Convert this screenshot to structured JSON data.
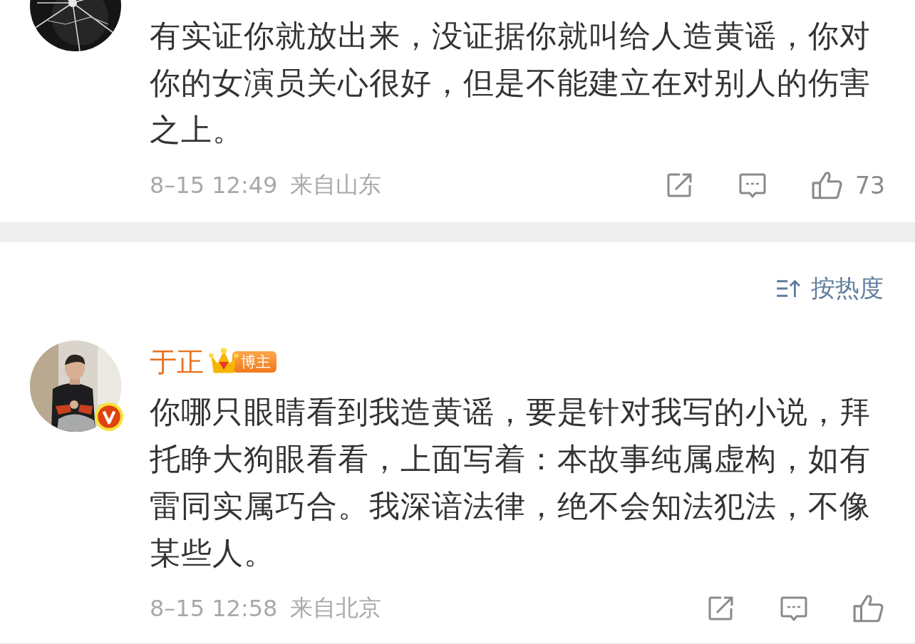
{
  "comments": [
    {
      "verified": false,
      "text": "有实证你就放出来，没证据你就叫给人造黄谣，你对你的女演员关心很好，但是不能建立在对别人的伤害之上。",
      "time": "8–15 12:49",
      "location": "来自山东",
      "likes": "73"
    },
    {
      "verified": true,
      "author": "于正",
      "badge": "博主",
      "text": "你哪只眼睛看到我造黄谣，要是针对我写的小说，拜托睁大狗眼看看，上面写着：本故事纯属虚构，如有雷同实属巧合。我深谙法律，绝不会知法犯法，不像某些人。",
      "time": "8–15 12:58",
      "location": "来自北京"
    }
  ],
  "sort": {
    "label": "按热度"
  }
}
